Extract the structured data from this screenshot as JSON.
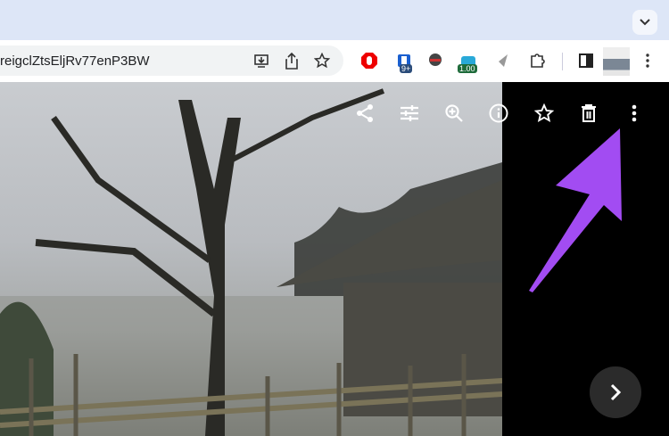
{
  "browser": {
    "url": "reigclZtsEljRv77enP3BW",
    "ext_badge_1": "9+",
    "ext_badge_2": "1.00"
  },
  "viewer": {
    "toolbar_icons": [
      "share-icon",
      "edit-icon",
      "zoom-icon",
      "info-icon",
      "star-icon",
      "trash-icon",
      "more-icon"
    ]
  },
  "colors": {
    "accent": "#a24cf2"
  }
}
